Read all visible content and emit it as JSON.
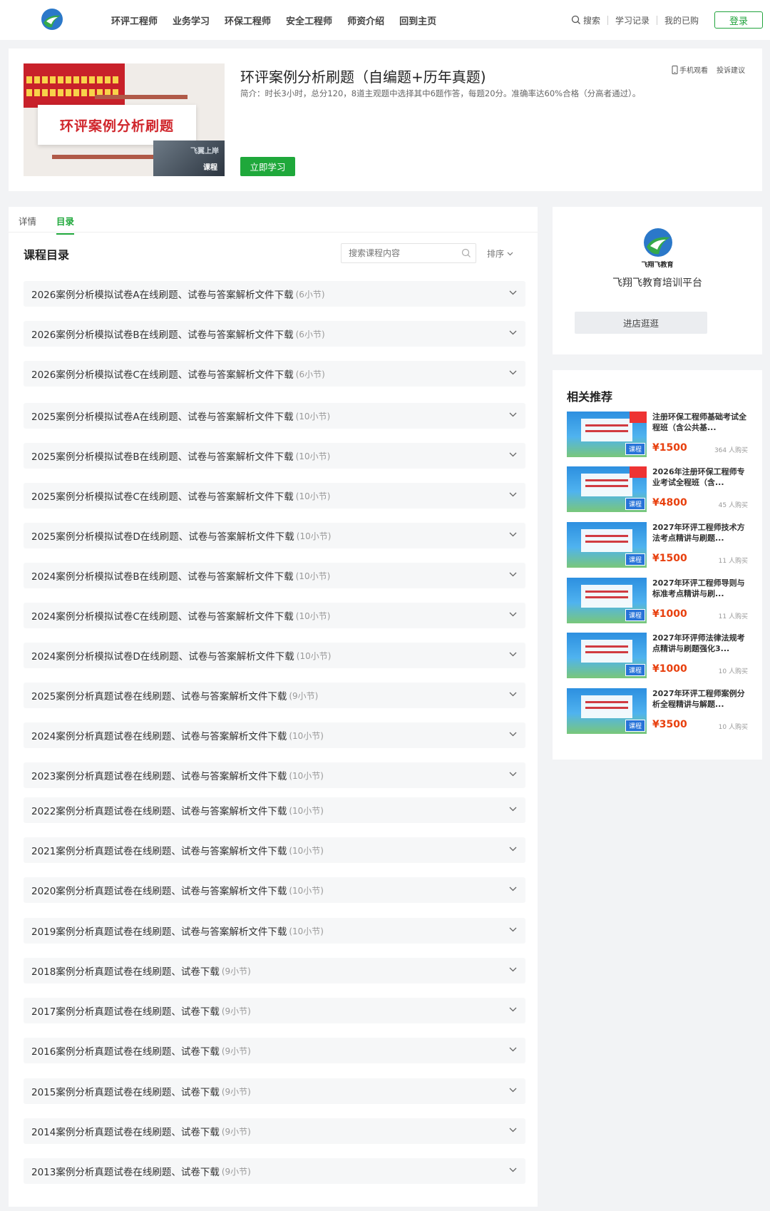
{
  "nav": {
    "items": [
      "环评工程师",
      "业务学习",
      "环保工程师",
      "安全工程师",
      "师资介绍",
      "回到主页"
    ],
    "search": "搜索",
    "history": "学习记录",
    "purchased": "我的已购",
    "login": "登录"
  },
  "course": {
    "title": "环评案例分析刷题（自编题+历年真题)",
    "desc": "简介：时长3小时，总分120，8道主观题中选择其中6题作答，每题20分。准确率达60%合格（分高者通过）。",
    "cover_title": "环评案例分析刷题",
    "cover_brand": "飞翼上岸",
    "cover_badge": "课程",
    "study_button": "立即学习",
    "mobile": "手机观看",
    "feedback": "投诉建议"
  },
  "tabs": {
    "detail": "详情",
    "catalog": "目录"
  },
  "toc": {
    "title": "课程目录",
    "search_placeholder": "搜索课程内容",
    "sort": "排序",
    "chapters": [
      {
        "title": "2026案例分析模拟试卷A在线刷题、试卷与答案解析文件下载",
        "count": "(6小节)"
      },
      {
        "title": "2026案例分析模拟试卷B在线刷题、试卷与答案解析文件下载",
        "count": "(6小节)"
      },
      {
        "title": "2026案例分析模拟试卷C在线刷题、试卷与答案解析文件下载",
        "count": "(6小节)"
      },
      {
        "title": "2025案例分析模拟试卷A在线刷题、试卷与答案解析文件下载",
        "count": "(10小节)"
      },
      {
        "title": "2025案例分析模拟试卷B在线刷题、试卷与答案解析文件下载",
        "count": "(10小节)"
      },
      {
        "title": "2025案例分析模拟试卷C在线刷题、试卷与答案解析文件下载",
        "count": "(10小节)"
      },
      {
        "title": "2025案例分析模拟试卷D在线刷题、试卷与答案解析文件下载",
        "count": "(10小节)"
      },
      {
        "title": "2024案例分析模拟试卷B在线刷题、试卷与答案解析文件下载",
        "count": "(10小节)"
      },
      {
        "title": "2024案例分析模拟试卷C在线刷题、试卷与答案解析文件下载",
        "count": "(10小节)"
      },
      {
        "title": "2024案例分析模拟试卷D在线刷题、试卷与答案解析文件下载",
        "count": "(10小节)"
      },
      {
        "title": "2025案例分析真题试卷在线刷题、试卷与答案解析文件下载",
        "count": "(9小节)"
      },
      {
        "title": "2024案例分析真题试卷在线刷题、试卷与答案解析文件下载",
        "count": "(10小节)"
      },
      {
        "title": "2023案例分析真题试卷在线刷题、试卷与答案解析文件下载",
        "count": "(10小节)"
      },
      {
        "title": "2022案例分析真题试卷在线刷题、试卷与答案解析文件下载",
        "count": "(10小节)"
      },
      {
        "title": "2021案例分析真题试卷在线刷题、试卷与答案解析文件下载",
        "count": "(10小节)"
      },
      {
        "title": "2020案例分析真题试卷在线刷题、试卷与答案解析文件下载",
        "count": "(10小节)"
      },
      {
        "title": "2019案例分析真题试卷在线刷题、试卷与答案解析文件下载",
        "count": "(10小节)"
      },
      {
        "title": "2018案例分析真题试卷在线刷题、试卷下载",
        "count": "(9小节)"
      },
      {
        "title": "2017案例分析真题试卷在线刷题、试卷下载",
        "count": "(9小节)"
      },
      {
        "title": "2016案例分析真题试卷在线刷题、试卷下载",
        "count": "(9小节)"
      },
      {
        "title": "2015案例分析真题试卷在线刷题、试卷下载",
        "count": "(9小节)"
      },
      {
        "title": "2014案例分析真题试卷在线刷题、试卷下载",
        "count": "(9小节)"
      },
      {
        "title": "2013案例分析真题试卷在线刷题、试卷下载",
        "count": "(9小节)"
      }
    ]
  },
  "shop": {
    "logo_text": "飞翔飞教育",
    "name": "飞翔飞教育培训平台",
    "button": "进店逛逛"
  },
  "recommend": {
    "title": "相关推荐",
    "badge": "课程",
    "items": [
      {
        "name": "注册环保工程师基础考试全程班（含公共基...",
        "price": "¥1500",
        "buyers": "364 人购买"
      },
      {
        "name": "2026年注册环保工程师专业考试全程班（含...",
        "price": "¥4800",
        "buyers": "45 人购买"
      },
      {
        "name": "2027年环评工程师技术方法考点精讲与刷题...",
        "price": "¥1500",
        "buyers": "11 人购买"
      },
      {
        "name": "2027年环评工程师导则与标准考点精讲与刷...",
        "price": "¥1000",
        "buyers": "11 人购买"
      },
      {
        "name": "2027年环评师法律法规考点精讲与刷题强化3...",
        "price": "¥1000",
        "buyers": "10 人购买"
      },
      {
        "name": "2027年环评工程师案例分析全程精讲与解题...",
        "price": "¥3500",
        "buyers": "10 人购买"
      }
    ]
  },
  "colors": {
    "accent": "#1fa83b",
    "price": "#e8400e"
  }
}
